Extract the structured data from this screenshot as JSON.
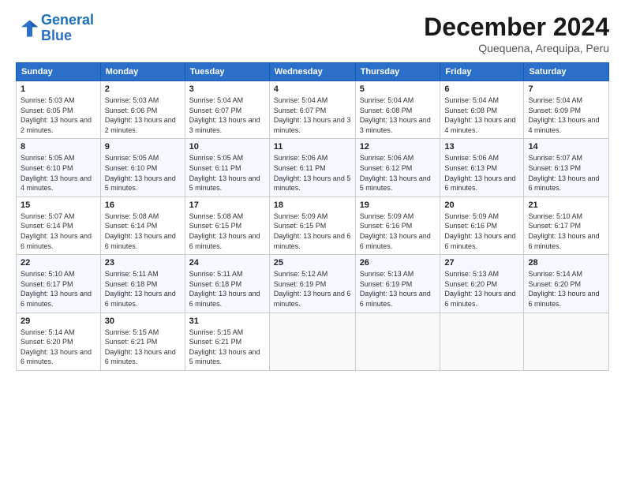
{
  "logo": {
    "line1": "General",
    "line2": "Blue"
  },
  "title": "December 2024",
  "subtitle": "Quequena, Arequipa, Peru",
  "days_of_week": [
    "Sunday",
    "Monday",
    "Tuesday",
    "Wednesday",
    "Thursday",
    "Friday",
    "Saturday"
  ],
  "weeks": [
    [
      {
        "num": "1",
        "sunrise": "5:03 AM",
        "sunset": "6:05 PM",
        "daylight": "13 hours and 2 minutes."
      },
      {
        "num": "2",
        "sunrise": "5:03 AM",
        "sunset": "6:06 PM",
        "daylight": "13 hours and 2 minutes."
      },
      {
        "num": "3",
        "sunrise": "5:04 AM",
        "sunset": "6:07 PM",
        "daylight": "13 hours and 3 minutes."
      },
      {
        "num": "4",
        "sunrise": "5:04 AM",
        "sunset": "6:07 PM",
        "daylight": "13 hours and 3 minutes."
      },
      {
        "num": "5",
        "sunrise": "5:04 AM",
        "sunset": "6:08 PM",
        "daylight": "13 hours and 3 minutes."
      },
      {
        "num": "6",
        "sunrise": "5:04 AM",
        "sunset": "6:08 PM",
        "daylight": "13 hours and 4 minutes."
      },
      {
        "num": "7",
        "sunrise": "5:04 AM",
        "sunset": "6:09 PM",
        "daylight": "13 hours and 4 minutes."
      }
    ],
    [
      {
        "num": "8",
        "sunrise": "5:05 AM",
        "sunset": "6:10 PM",
        "daylight": "13 hours and 4 minutes."
      },
      {
        "num": "9",
        "sunrise": "5:05 AM",
        "sunset": "6:10 PM",
        "daylight": "13 hours and 5 minutes."
      },
      {
        "num": "10",
        "sunrise": "5:05 AM",
        "sunset": "6:11 PM",
        "daylight": "13 hours and 5 minutes."
      },
      {
        "num": "11",
        "sunrise": "5:06 AM",
        "sunset": "6:11 PM",
        "daylight": "13 hours and 5 minutes."
      },
      {
        "num": "12",
        "sunrise": "5:06 AM",
        "sunset": "6:12 PM",
        "daylight": "13 hours and 5 minutes."
      },
      {
        "num": "13",
        "sunrise": "5:06 AM",
        "sunset": "6:13 PM",
        "daylight": "13 hours and 6 minutes."
      },
      {
        "num": "14",
        "sunrise": "5:07 AM",
        "sunset": "6:13 PM",
        "daylight": "13 hours and 6 minutes."
      }
    ],
    [
      {
        "num": "15",
        "sunrise": "5:07 AM",
        "sunset": "6:14 PM",
        "daylight": "13 hours and 6 minutes."
      },
      {
        "num": "16",
        "sunrise": "5:08 AM",
        "sunset": "6:14 PM",
        "daylight": "13 hours and 6 minutes."
      },
      {
        "num": "17",
        "sunrise": "5:08 AM",
        "sunset": "6:15 PM",
        "daylight": "13 hours and 6 minutes."
      },
      {
        "num": "18",
        "sunrise": "5:09 AM",
        "sunset": "6:15 PM",
        "daylight": "13 hours and 6 minutes."
      },
      {
        "num": "19",
        "sunrise": "5:09 AM",
        "sunset": "6:16 PM",
        "daylight": "13 hours and 6 minutes."
      },
      {
        "num": "20",
        "sunrise": "5:09 AM",
        "sunset": "6:16 PM",
        "daylight": "13 hours and 6 minutes."
      },
      {
        "num": "21",
        "sunrise": "5:10 AM",
        "sunset": "6:17 PM",
        "daylight": "13 hours and 6 minutes."
      }
    ],
    [
      {
        "num": "22",
        "sunrise": "5:10 AM",
        "sunset": "6:17 PM",
        "daylight": "13 hours and 6 minutes."
      },
      {
        "num": "23",
        "sunrise": "5:11 AM",
        "sunset": "6:18 PM",
        "daylight": "13 hours and 6 minutes."
      },
      {
        "num": "24",
        "sunrise": "5:11 AM",
        "sunset": "6:18 PM",
        "daylight": "13 hours and 6 minutes."
      },
      {
        "num": "25",
        "sunrise": "5:12 AM",
        "sunset": "6:19 PM",
        "daylight": "13 hours and 6 minutes."
      },
      {
        "num": "26",
        "sunrise": "5:13 AM",
        "sunset": "6:19 PM",
        "daylight": "13 hours and 6 minutes."
      },
      {
        "num": "27",
        "sunrise": "5:13 AM",
        "sunset": "6:20 PM",
        "daylight": "13 hours and 6 minutes."
      },
      {
        "num": "28",
        "sunrise": "5:14 AM",
        "sunset": "6:20 PM",
        "daylight": "13 hours and 6 minutes."
      }
    ],
    [
      {
        "num": "29",
        "sunrise": "5:14 AM",
        "sunset": "6:20 PM",
        "daylight": "13 hours and 6 minutes."
      },
      {
        "num": "30",
        "sunrise": "5:15 AM",
        "sunset": "6:21 PM",
        "daylight": "13 hours and 6 minutes."
      },
      {
        "num": "31",
        "sunrise": "5:15 AM",
        "sunset": "6:21 PM",
        "daylight": "13 hours and 5 minutes."
      },
      null,
      null,
      null,
      null
    ]
  ]
}
